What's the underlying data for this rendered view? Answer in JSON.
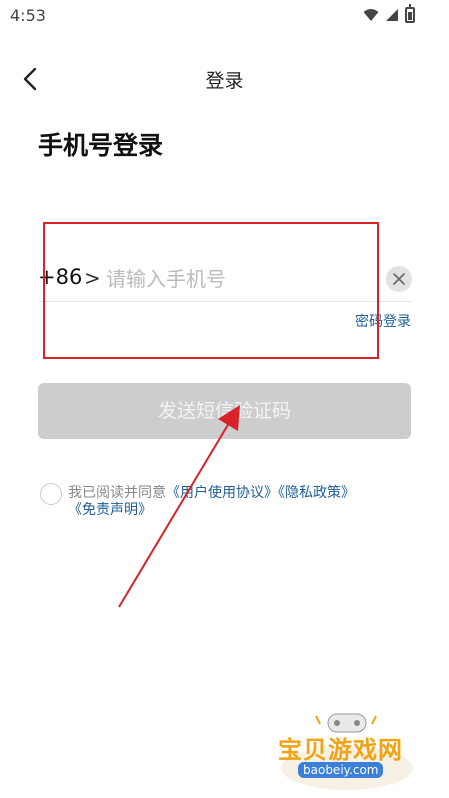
{
  "status_bar": {
    "time": "4:53"
  },
  "header": {
    "title": "登录"
  },
  "page": {
    "title": "手机号登录"
  },
  "phone": {
    "country_code": "+86",
    "chevron": ">",
    "placeholder": "请输入手机号",
    "value": ""
  },
  "password_login_link": "密码登录",
  "send_code_button": "发送短信验证码",
  "agreement": {
    "prefix": "我已阅读并同意",
    "user_agreement": "《用户使用协议》",
    "privacy_policy": "《隐私政策》",
    "disclaimer": "《免责声明》"
  },
  "watermark": {
    "text": "宝贝游戏网",
    "url": "baobeiy.com"
  },
  "colors": {
    "annotation": "#d8232a",
    "link": "#1f5f96",
    "button_disabled": "#cdcdcd",
    "watermark": "#f0a314"
  }
}
